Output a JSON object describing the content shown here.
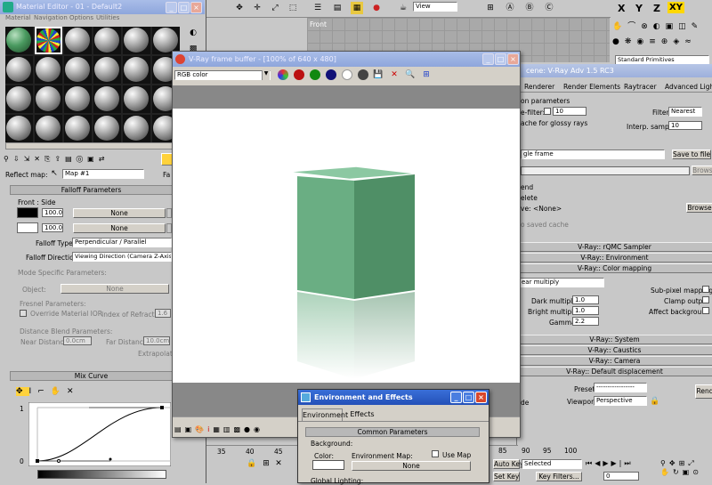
{
  "viewport_top": {
    "label": "Front",
    "view_dropdown": "View"
  },
  "material_editor": {
    "title": "Material Editor - 01 - Default2",
    "menu": [
      "Material",
      "Navigation",
      "Options",
      "Utilities"
    ],
    "reflect_label": "Reflect map:",
    "map_name": "Map #1",
    "map_type_btn": "Fa",
    "falloff_rollout": "Falloff Parameters",
    "front_side_label": "Front : Side",
    "front_value": "100.0",
    "side_value": "100.0",
    "none_label": "None",
    "falloff_type_label": "Falloff Type:",
    "falloff_type_value": "Perpendicular / Parallel",
    "falloff_dir_label": "Falloff Direction:",
    "falloff_dir_value": "Viewing Direction (Camera Z-Axis)",
    "mode_specific_label": "Mode Specific Parameters:",
    "object_label": "Object:",
    "object_value": "None",
    "fresnel_label": "Fresnel Parameters:",
    "override_ior_label": "Override Material IOR",
    "ior_label": "Index of Refraction",
    "ior_value": "1.6",
    "distance_blend_label": "Distance Blend Parameters:",
    "near_label": "Near Distance:",
    "near_value": "0.0cm",
    "far_label": "Far Distance:",
    "far_value": "10.0cm",
    "extrapolate_label": "Extrapolate",
    "mix_curve_rollout": "Mix Curve",
    "curve_y_top": "1",
    "curve_y_bottom": "0"
  },
  "vfb": {
    "title": "V-Ray frame buffer - [100% of 640 x 480]",
    "channel": "RGB color"
  },
  "render_scene": {
    "title": "cene: V-Ray Adv 1.5 RC3",
    "tabs": [
      "Renderer",
      "Render Elements",
      "Raytracer",
      "Advanced Lighting"
    ],
    "partial_label": "on parameters",
    "filter_label": "e-filter:",
    "filter_value": "10",
    "filter2_label": "Filter:",
    "filter2_value": "Nearest",
    "glossy_label": "ache for glossy rays",
    "interp_label": "Interp. samples:",
    "interp_value": "10",
    "mode_value": "gle frame",
    "save_btn": "Save to file",
    "browse_btn": "Browse",
    "end_label": "end",
    "delete_label": "elete",
    "ve_label": "ve: <None>",
    "browse2_btn": "Browse",
    "saved_cache_label": "o saved cache",
    "rollouts": [
      "V-Ray:: rQMC Sampler",
      "V-Ray:: Environment",
      "V-Ray:: Color mapping"
    ],
    "colormap_type": "ear multiply",
    "subpixel_label": "Sub-pixel mapping",
    "dark_label": "Dark multiplier:",
    "dark_value": "1.0",
    "clamp_label": "Clamp output",
    "bright_label": "Bright multiplier:",
    "bright_value": "1.0",
    "affect_bg_label": "Affect background",
    "gamma_label": "Gamma:",
    "gamma_value": "2.2",
    "rollouts2": [
      "V-Ray:: System",
      "V-Ray:: Caustics",
      "V-Ray:: Camera",
      "V-Ray:: Default displacement"
    ],
    "preset_label": "Preset:",
    "preset_value": "-----------------",
    "viewport_label": "Viewport:",
    "viewport_value": "Perspective",
    "de_label": "de",
    "render_btn": "Rend"
  },
  "env_effects": {
    "title": "Environment and Effects",
    "tabs": [
      "Environment",
      "Effects"
    ],
    "common_rollout": "Common Parameters",
    "background_label": "Background:",
    "color_label": "Color:",
    "env_map_label": "Environment Map:",
    "use_map_label": "Use Map",
    "none_label": "None",
    "global_lighting_label": "Global Lighting:"
  },
  "right_panel": {
    "dropdown": "Standard Primitives",
    "axis_labels": [
      "X",
      "Y",
      "Z",
      "XY"
    ]
  },
  "timeline": {
    "ticks": [
      "35",
      "40",
      "45",
      "50",
      "85",
      "90",
      "95",
      "100"
    ],
    "auto_key": "Auto Key",
    "selected": "Selected",
    "set_key": "Set Key",
    "key_filters": "Key Filters...",
    "frame_value": "0"
  },
  "colors": {
    "title_active": "#2f63cf",
    "viewport_bg": "#a9a9a9",
    "cube_green": "#6aae83"
  }
}
